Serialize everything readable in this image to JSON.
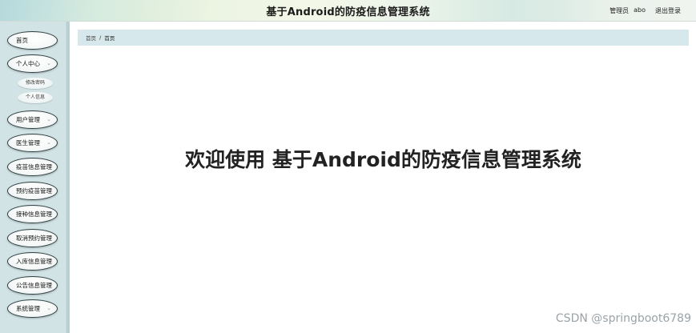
{
  "header": {
    "title": "基于Android的防疫信息管理系统",
    "user_role": "管理员",
    "username": "abo",
    "logout_label": "退出登录"
  },
  "sidebar": {
    "items": [
      {
        "label": "首页",
        "has_chevron": false
      },
      {
        "label": "个人中心",
        "has_chevron": true,
        "expanded": true
      },
      {
        "label": "用户管理",
        "has_chevron": true
      },
      {
        "label": "医生管理",
        "has_chevron": true
      },
      {
        "label": "疫苗信息管理",
        "has_chevron": false
      },
      {
        "label": "预约疫苗管理",
        "has_chevron": false
      },
      {
        "label": "接种信息管理",
        "has_chevron": false
      },
      {
        "label": "取消预约管理",
        "has_chevron": false
      },
      {
        "label": "入库信息管理",
        "has_chevron": false
      },
      {
        "label": "公告信息管理",
        "has_chevron": false
      },
      {
        "label": "系统管理",
        "has_chevron": true
      }
    ],
    "submenu": [
      {
        "label": "修改密码"
      },
      {
        "label": "个人信息"
      }
    ]
  },
  "breadcrumb": {
    "home": "首页",
    "separator": "/",
    "current": "首页"
  },
  "main": {
    "welcome_text": "欢迎使用 基于Android的防疫信息管理系统"
  },
  "watermark": "CSDN @springboot6789",
  "colors": {
    "sidebar_bg": "#d2e3e6",
    "breadcrumb_bg": "#d7e8ec",
    "button_border": "#2d3e40"
  },
  "icons": {
    "chevron": "chevron-down-icon"
  }
}
